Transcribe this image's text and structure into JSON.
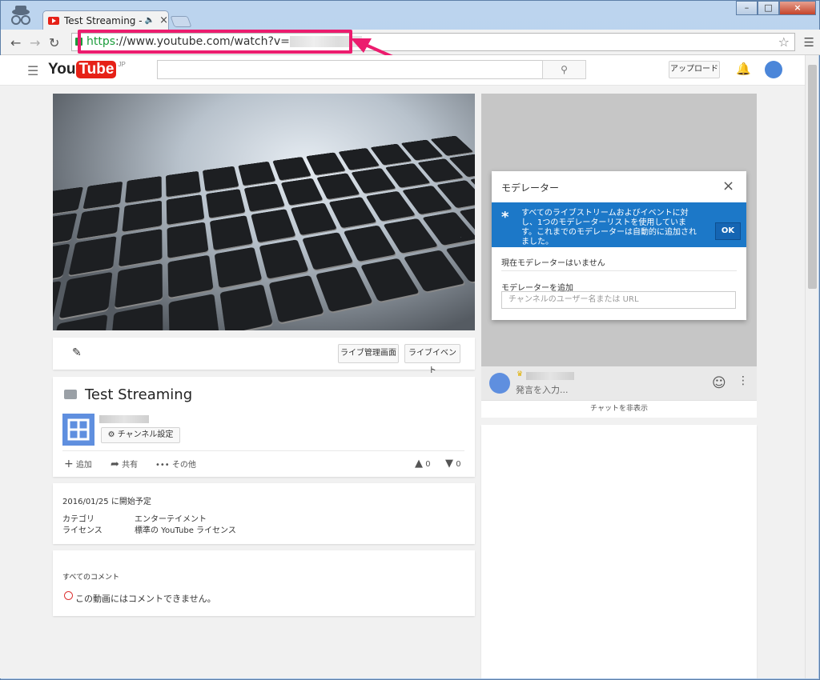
{
  "browser": {
    "tab_title": "Test Streaming - You",
    "url_scheme": "https",
    "url_rest": "://www.youtube.com/watch?v="
  },
  "youtube": {
    "logo_you": "You",
    "logo_tube": "Tube",
    "logo_region": "JP",
    "upload_label": "アップロード"
  },
  "video_actions": {
    "live_dashboard": "ライブ管理画面",
    "live_events": "ライブイベント"
  },
  "info": {
    "title": "Test Streaming",
    "channel_settings": "チャンネル設定",
    "add": "追加",
    "share": "共有",
    "more": "その他",
    "likes": "0",
    "dislikes": "0"
  },
  "details": {
    "scheduled": "2016/01/25 に開始予定",
    "category_label": "カテゴリ",
    "category_value": "エンターテイメント",
    "license_label": "ライセンス",
    "license_value": "標準の YouTube ライセンス"
  },
  "comments": {
    "header": "すべてのコメント",
    "disabled_msg": "この動画にはコメントできません。"
  },
  "moderator": {
    "title": "モデレーター",
    "notice": "すべてのライブストリームおよびイベントに対し、1つのモデレーターリストを使用しています。これまでのモデレーターは自動的に追加されました。",
    "ok": "OK",
    "none": "現在モデレーターはいません",
    "add_label": "モデレーターを追加",
    "add_placeholder": "チャンネルのユーザー名または URL"
  },
  "chat": {
    "input_placeholder": "発言を入力...",
    "hide": "チャットを非表示"
  }
}
